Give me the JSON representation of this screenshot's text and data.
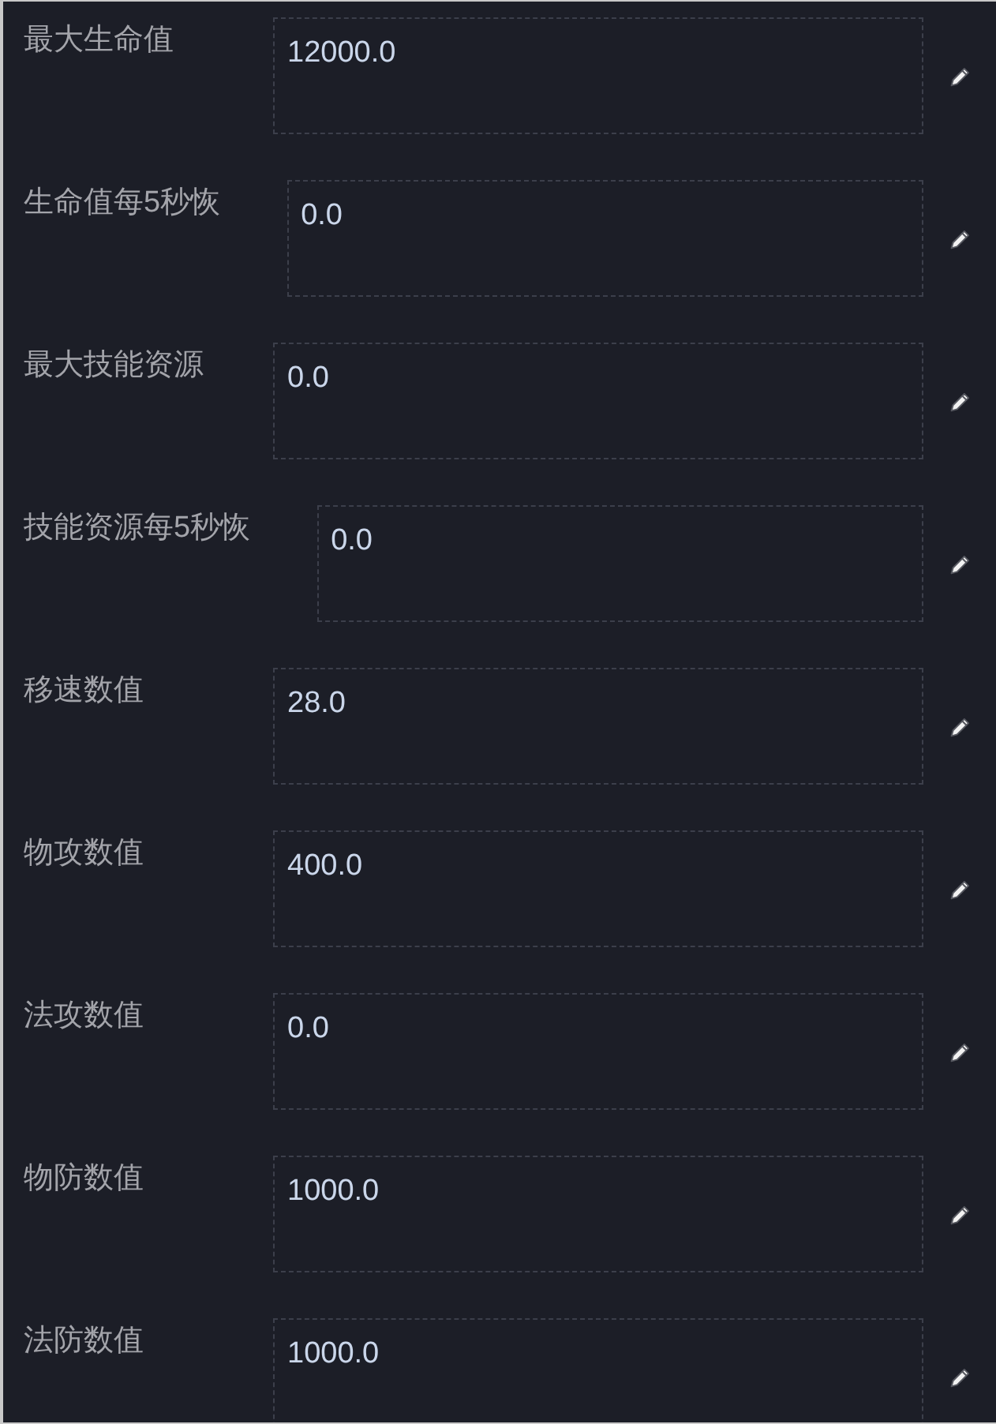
{
  "fields": [
    {
      "label": "最大生命值",
      "value": "12000.0"
    },
    {
      "label": "生命值每5秒恢",
      "value": "0.0"
    },
    {
      "label": "最大技能资源",
      "value": "0.0"
    },
    {
      "label": "技能资源每5秒恢",
      "value": "0.0"
    },
    {
      "label": "移速数值",
      "value": "28.0"
    },
    {
      "label": "物攻数值",
      "value": "400.0"
    },
    {
      "label": "法攻数值",
      "value": "0.0"
    },
    {
      "label": "物防数值",
      "value": "1000.0"
    },
    {
      "label": "法防数值",
      "value": "1000.0"
    }
  ]
}
